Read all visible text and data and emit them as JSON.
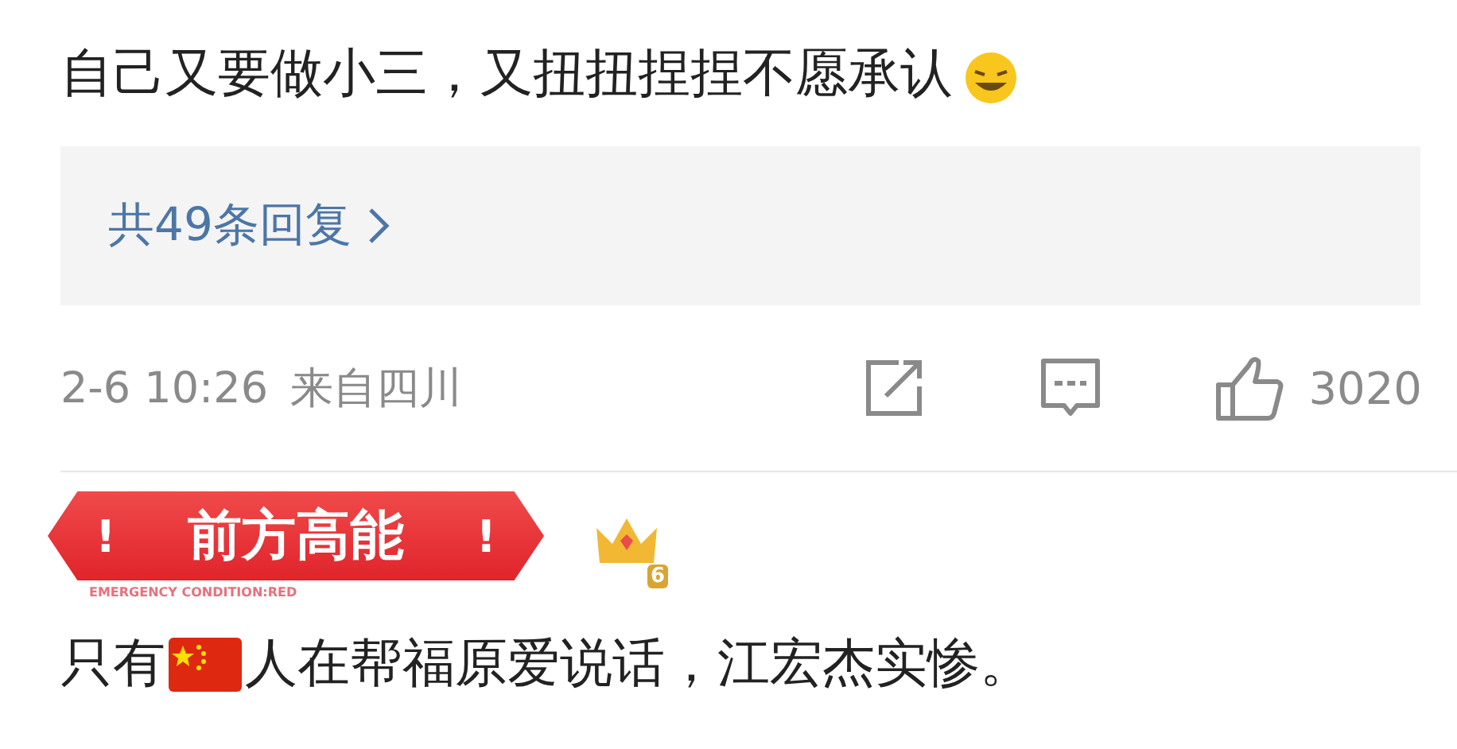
{
  "comments": [
    {
      "text": "自己又要做小三，又扭扭捏捏不愿承认",
      "replies": "共49条回复",
      "time": "2-6 10:26",
      "location": "来自四川",
      "likes": "3020"
    },
    {
      "badge": {
        "title": "前方高能",
        "mark": "!",
        "subtitle": "EMERGENCY CONDITION:RED"
      },
      "level": "6",
      "text_before": "只有",
      "text_after": "人在帮福原爱说话，江宏杰实惨。"
    }
  ]
}
